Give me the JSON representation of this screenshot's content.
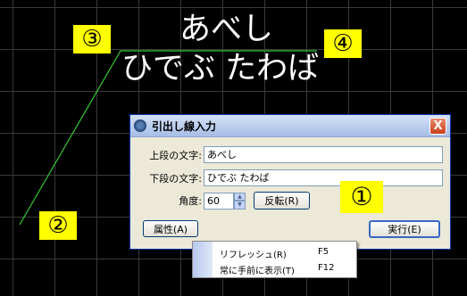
{
  "canvas": {
    "upper_text": "あべし",
    "lower_text": "ひでぶ たわば",
    "leader_color": "#33cc33",
    "markers": {
      "one": "①",
      "two": "②",
      "three": "③",
      "four": "④"
    }
  },
  "dialog": {
    "title": "引出し線入力",
    "close_label": "X",
    "upper_label": "上段の文字:",
    "upper_value": "あべし",
    "lower_label": "下段の文字:",
    "lower_value": "ひでぶ たわば",
    "angle_label": "角度:",
    "angle_value": "60",
    "reverse_label": "反転(R)",
    "attr_label": "属性(A)",
    "exec_label": "実行(E)"
  },
  "context_menu": {
    "items": [
      {
        "label": "リフレッシュ(R)",
        "shortcut": "F5"
      },
      {
        "label": "常に手前に表示(T)",
        "shortcut": "F12"
      }
    ]
  }
}
